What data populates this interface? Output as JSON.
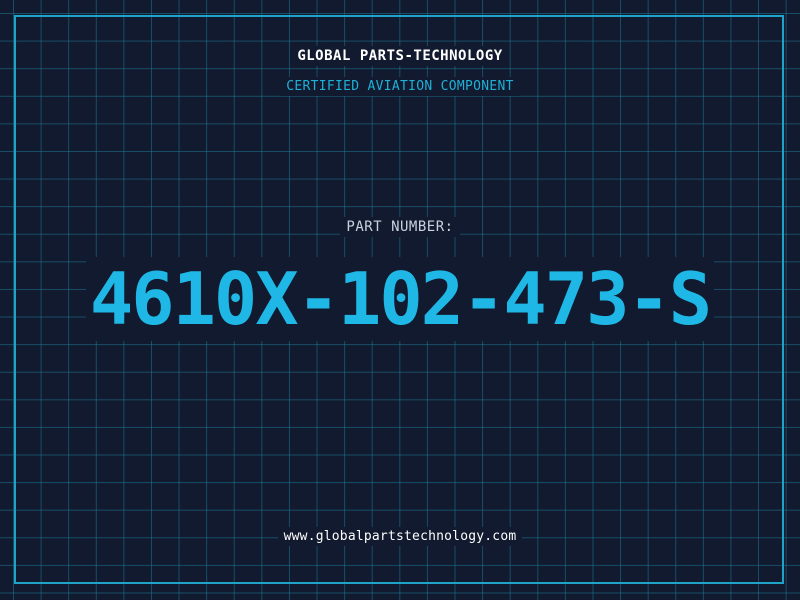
{
  "header": {
    "company": "GLOBAL PARTS-TECHNOLOGY",
    "tagline": "CERTIFIED AVIATION COMPONENT"
  },
  "part": {
    "label": "PART NUMBER:",
    "number": "4610X-102-473-S"
  },
  "footer": {
    "website": "www.globalpartstechnology.com"
  },
  "colors": {
    "background": "#111a2e",
    "grid": "#1e7896",
    "frame": "#1fa3c8",
    "accent": "#1fb8e6",
    "text": "#ffffff"
  }
}
